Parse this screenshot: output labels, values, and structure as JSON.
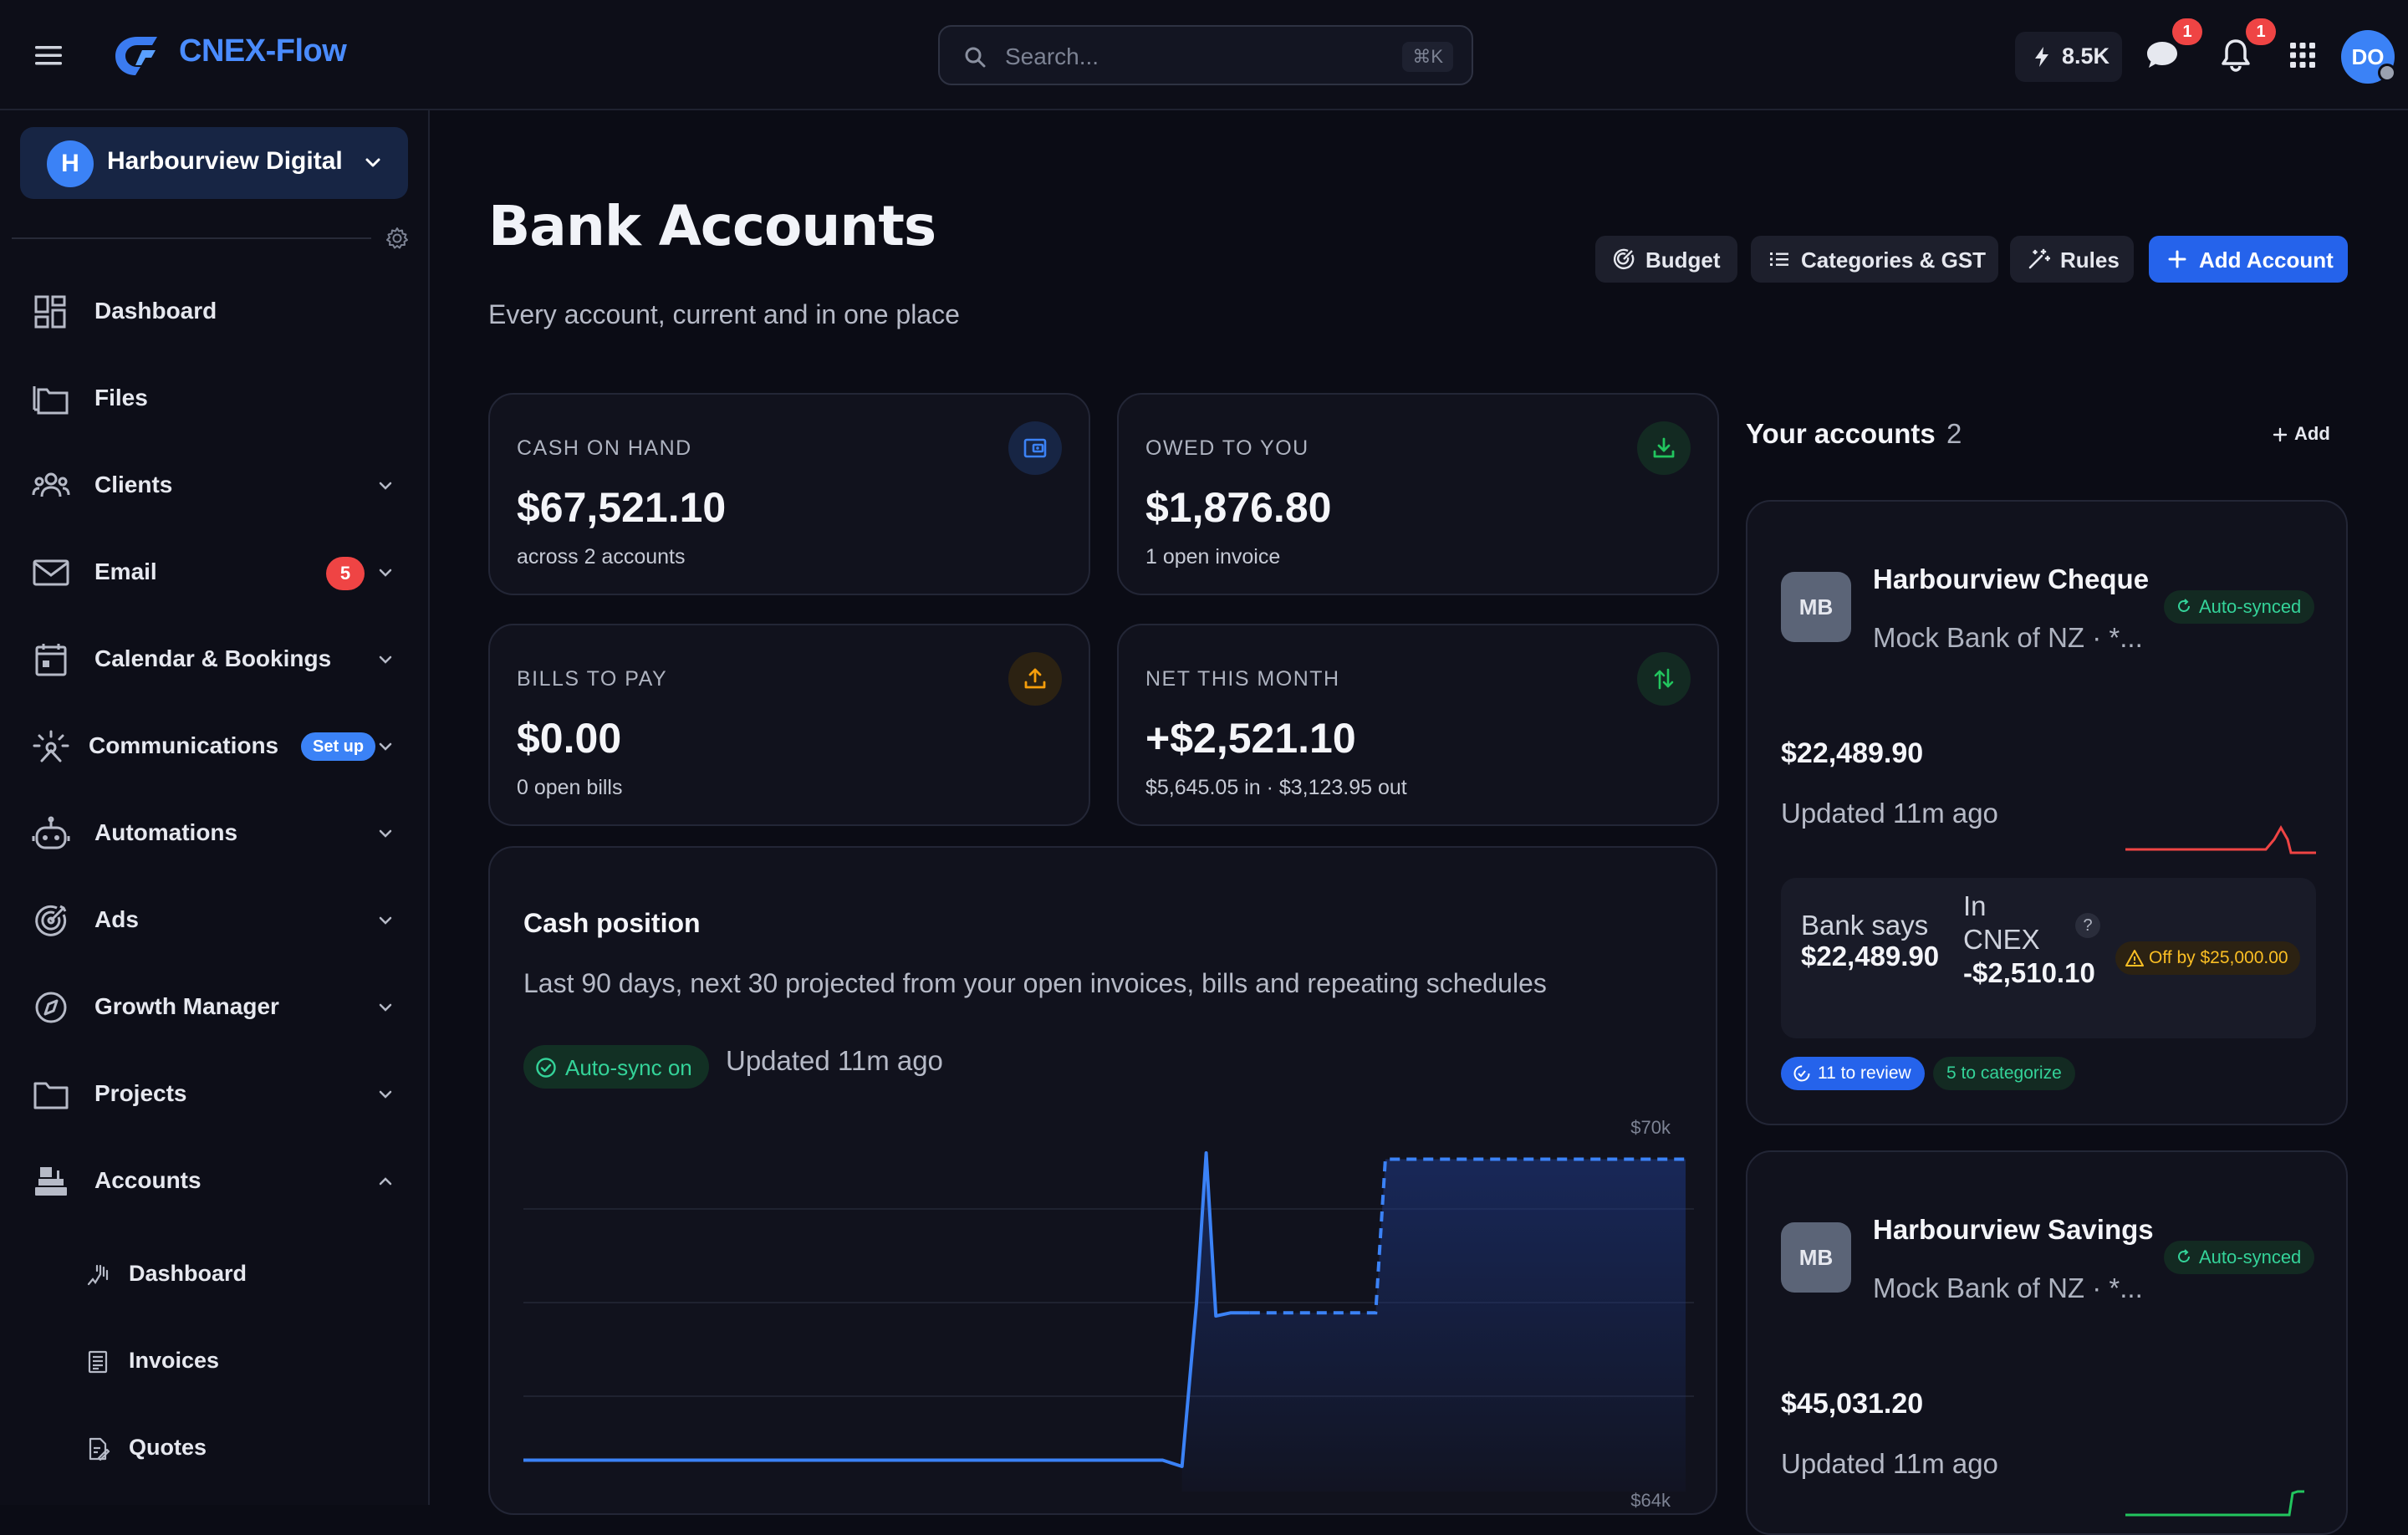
{
  "app": {
    "name": "CNEX-Flow",
    "search_placeholder": "Search...",
    "search_shortcut": "⌘K",
    "credits": "8.5K",
    "messages_badge": "1",
    "notifications_badge": "1",
    "user_initials": "DO"
  },
  "sidebar": {
    "org_initial": "H",
    "org_name": "Harbourview Digital",
    "items": [
      {
        "label": "Dashboard",
        "icon": "dashboard-icon"
      },
      {
        "label": "Files",
        "icon": "files-icon"
      },
      {
        "label": "Clients",
        "icon": "clients-icon"
      },
      {
        "label": "Email",
        "icon": "email-icon",
        "badge": "5"
      },
      {
        "label": "Calendar & Bookings",
        "icon": "calendar-icon"
      },
      {
        "label": "Communications",
        "icon": "communications-icon",
        "tag": "Set up"
      },
      {
        "label": "Automations",
        "icon": "robot-icon"
      },
      {
        "label": "Ads",
        "icon": "target-icon"
      },
      {
        "label": "Growth Manager",
        "icon": "compass-icon"
      },
      {
        "label": "Projects",
        "icon": "folder-icon"
      },
      {
        "label": "Accounts",
        "icon": "register-icon"
      }
    ],
    "sub_items": [
      {
        "label": "Dashboard",
        "icon": "chart-hand-icon"
      },
      {
        "label": "Invoices",
        "icon": "invoice-icon"
      },
      {
        "label": "Quotes",
        "icon": "quote-icon"
      }
    ]
  },
  "page": {
    "title": "Bank Accounts",
    "subtitle": "Every account, current and in one place",
    "buttons": {
      "budget": "Budget",
      "categories": "Categories & GST",
      "rules": "Rules",
      "add_account": "Add Account"
    }
  },
  "stats": [
    {
      "label": "CASH ON HAND",
      "value": "$67,521.10",
      "sub": "across 2 accounts",
      "color": "#3b82f6"
    },
    {
      "label": "OWED TO YOU",
      "value": "$1,876.80",
      "sub": "1 open invoice",
      "color": "#22c55e"
    },
    {
      "label": "BILLS TO PAY",
      "value": "$0.00",
      "sub": "0 open bills",
      "color": "#f59e0b"
    },
    {
      "label": "NET THIS MONTH",
      "value": "+$2,521.10",
      "sub": "$5,645.05 in · $3,123.95 out",
      "color": "#22c55e"
    }
  ],
  "cash_position": {
    "title": "Cash position",
    "subtitle": "Last 90 days, next 30 projected from your open invoices, bills and repeating schedules",
    "sync_label": "Auto-sync on",
    "updated": "Updated 11m ago",
    "y_top_label": "$70k",
    "y_bottom_label": "$64k"
  },
  "chart_data": {
    "type": "line",
    "ylim": [
      64000,
      70000
    ],
    "ticks": [
      "$70k",
      "$64k"
    ],
    "series": [
      {
        "kind": "actual",
        "x": [
          0,
          66,
          68,
          69.5,
          70.5,
          71.5,
          73,
          75
        ],
        "values": [
          64500,
          64500,
          64400,
          67000,
          69400,
          66800,
          66850,
          66850
        ]
      },
      {
        "kind": "projected",
        "x": [
          75,
          88,
          89,
          120
        ],
        "values": [
          66850,
          66850,
          69300,
          69300
        ]
      }
    ],
    "color": "#3b82f6"
  },
  "accounts": {
    "heading": "Your accounts",
    "count": "2",
    "add_label": "Add",
    "items": [
      {
        "initials": "MB",
        "name": "Harbourview Cheque",
        "bank": "Mock Bank of NZ · *...",
        "sync": "Auto-synced",
        "balance": "$22,489.90",
        "updated": "Updated 11m ago",
        "bank_says_label": "Bank says",
        "bank_says_value": "$22,489.90",
        "in_cnex_label": "In CNEX",
        "in_cnex_value": "-$2,510.10",
        "help": "?",
        "off_by": "Off by $25,000.00",
        "to_review": "11 to review",
        "to_categorize": "5 to categorize",
        "spark_color": "#ef4444"
      },
      {
        "initials": "MB",
        "name": "Harbourview Savings",
        "bank": "Mock Bank of NZ · *...",
        "sync": "Auto-synced",
        "balance": "$45,031.20",
        "updated": "Updated 11m ago",
        "spark_color": "#22c55e"
      }
    ]
  }
}
